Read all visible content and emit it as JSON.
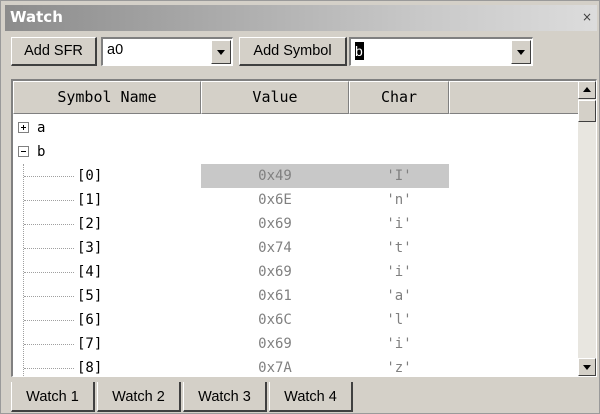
{
  "window": {
    "title": "Watch",
    "close_glyph": "×"
  },
  "toolbar": {
    "add_sfr_label": "Add SFR",
    "sfr_combo_value": "a0",
    "add_symbol_label": "Add Symbol",
    "symbol_combo_value": "b"
  },
  "grid": {
    "columns": [
      "Symbol Name",
      "Value",
      "Char"
    ],
    "tree": [
      {
        "name": "a",
        "expander": "+"
      },
      {
        "name": "b",
        "expander": "−"
      }
    ],
    "rows": [
      {
        "index": "[0]",
        "value": "0x49",
        "char": "'I'",
        "selected": true
      },
      {
        "index": "[1]",
        "value": "0x6E",
        "char": "'n'"
      },
      {
        "index": "[2]",
        "value": "0x69",
        "char": "'i'"
      },
      {
        "index": "[3]",
        "value": "0x74",
        "char": "'t'"
      },
      {
        "index": "[4]",
        "value": "0x69",
        "char": "'i'"
      },
      {
        "index": "[5]",
        "value": "0x61",
        "char": "'a'"
      },
      {
        "index": "[6]",
        "value": "0x6C",
        "char": "'l'"
      },
      {
        "index": "[7]",
        "value": "0x69",
        "char": "'i'"
      },
      {
        "index": "[8]",
        "value": "0x7A",
        "char": "'z'"
      }
    ]
  },
  "tabs": [
    {
      "label": "Watch 1",
      "active": true
    },
    {
      "label": "Watch 2"
    },
    {
      "label": "Watch 3"
    },
    {
      "label": "Watch 4"
    }
  ]
}
